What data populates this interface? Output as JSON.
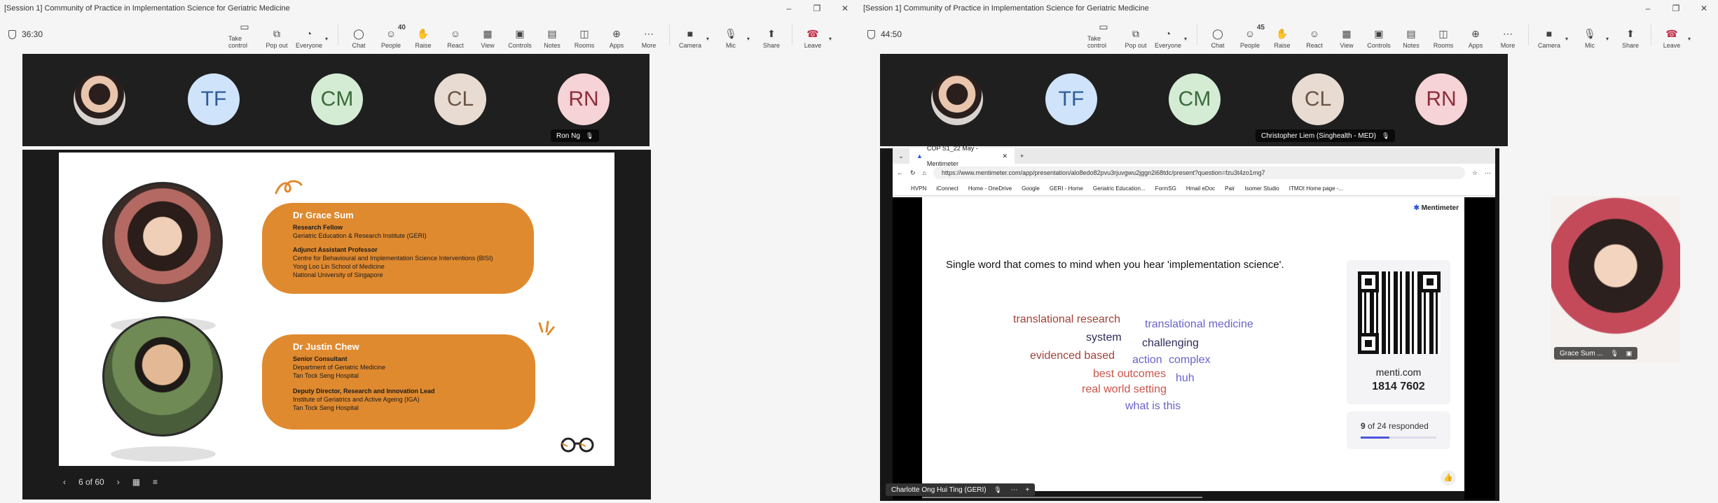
{
  "left": {
    "window_title": "[Session 1] Community of Practice in Implementation Science for Geriatric Medicine",
    "timer": "36:30",
    "people_count": "40",
    "toolbar": [
      {
        "id": "take-control",
        "label": "Take control",
        "icon": "share-screen-icon"
      },
      {
        "id": "pop-out",
        "label": "Pop out",
        "icon": "pop-out-icon"
      },
      {
        "id": "everyone",
        "label": "Everyone",
        "icon": "view-icon"
      },
      {
        "id": "chat",
        "label": "Chat",
        "icon": "chat-icon"
      },
      {
        "id": "people",
        "label": "People",
        "icon": "people-icon"
      },
      {
        "id": "raise",
        "label": "Raise",
        "icon": "hand-icon"
      },
      {
        "id": "react",
        "label": "React",
        "icon": "smiley-icon"
      },
      {
        "id": "view",
        "label": "View",
        "icon": "grid-icon"
      },
      {
        "id": "controls",
        "label": "Controls",
        "icon": "controls-icon"
      },
      {
        "id": "notes",
        "label": "Notes",
        "icon": "notes-icon"
      },
      {
        "id": "rooms",
        "label": "Rooms",
        "icon": "rooms-icon"
      },
      {
        "id": "apps",
        "label": "Apps",
        "icon": "apps-icon"
      },
      {
        "id": "more",
        "label": "More",
        "icon": "more-icon"
      },
      {
        "id": "camera",
        "label": "Camera",
        "icon": "camera-off-icon"
      },
      {
        "id": "mic",
        "label": "Mic",
        "icon": "mic-off-icon"
      },
      {
        "id": "share",
        "label": "Share",
        "icon": "share-icon"
      },
      {
        "id": "leave",
        "label": "Leave",
        "icon": "phone-hangup-icon"
      }
    ],
    "participants": [
      "TF",
      "CM",
      "CL",
      "RN"
    ],
    "nametag": "Ron Ng",
    "slide": {
      "person1": {
        "name": "Dr Grace Sum",
        "lines": [
          {
            "text": "Research Fellow",
            "bold": true
          },
          {
            "text": "Geriatric Education & Research Institute (GERI)",
            "bold": false
          },
          {
            "text": "Adjunct Assistant Professor",
            "bold": true,
            "gap": true
          },
          {
            "text": "Centre for Behavioural and Implementation Science Interventions (BISI)",
            "bold": false
          },
          {
            "text": "Yong Loo Lin School of Medicine",
            "bold": false
          },
          {
            "text": "National University of Singapore",
            "bold": false
          }
        ]
      },
      "person2": {
        "name": "Dr Justin Chew",
        "lines": [
          {
            "text": "Senior Consultant",
            "bold": true
          },
          {
            "text": "Department of Geriatric Medicine",
            "bold": false
          },
          {
            "text": "Tan Tock Seng Hospital",
            "bold": false
          },
          {
            "text": "Deputy Director, Research and Innovation Lead",
            "bold": true,
            "gap": true
          },
          {
            "text": "Institute of Geriatrics and Active Ageing (IGA)",
            "bold": false
          },
          {
            "text": "Tan Tock Seng Hospital",
            "bold": false
          }
        ]
      }
    },
    "slide_counter": "6 of 60"
  },
  "right": {
    "window_title": "[Session 1] Community of Practice in Implementation Science for Geriatric Medicine",
    "timer": "44:50",
    "people_count": "45",
    "participants": [
      "TF",
      "CM",
      "CL",
      "RN"
    ],
    "nametag": "Christopher Liem (Singhealth - MED)",
    "browser": {
      "tab_title": "COP S1_22 May - Mentimeter",
      "url": "https://www.mentimeter.com/app/presentation/alo8edo82pvu3rjuvgwu2jggn2i68tdc/present?question=fzu3t4zo1mg7",
      "favorites": [
        "HVPN",
        "iConnect",
        "Home - OneDrive",
        "Google",
        "GERI - Home",
        "Geriatric Education...",
        "FormSG",
        "Hmail eDoc",
        "Pair",
        "Isomer Studio",
        "ITMOI Home page -..."
      ]
    },
    "menti": {
      "brand": "Mentimeter",
      "question": "Single word that comes to mind when you hear 'implementation science'.",
      "words": [
        {
          "text": "translational research",
          "color": "#a0433a"
        },
        {
          "text": "translational medicine",
          "color": "#6a63c9"
        },
        {
          "text": "system",
          "color": "#2e2c5a"
        },
        {
          "text": "challenging",
          "color": "#2e2c5a"
        },
        {
          "text": "evidenced based",
          "color": "#a0433a"
        },
        {
          "text": "action",
          "color": "#6a63c9"
        },
        {
          "text": "complex",
          "color": "#6a63c9"
        },
        {
          "text": "best outcomes",
          "color": "#c9534a"
        },
        {
          "text": "huh",
          "color": "#6a63c9"
        },
        {
          "text": "real world setting",
          "color": "#c9534a"
        },
        {
          "text": "what is this",
          "color": "#6a63c9"
        }
      ],
      "site": "menti.com",
      "code": "1814 7602",
      "responded_count": "9",
      "responded_rest": "of 24 responded",
      "responded_fraction": 0.375
    },
    "self_view_name": "Grace Sum ...",
    "bottom_nametag": "Charlotte Ong Hui Ting (GERI)"
  }
}
